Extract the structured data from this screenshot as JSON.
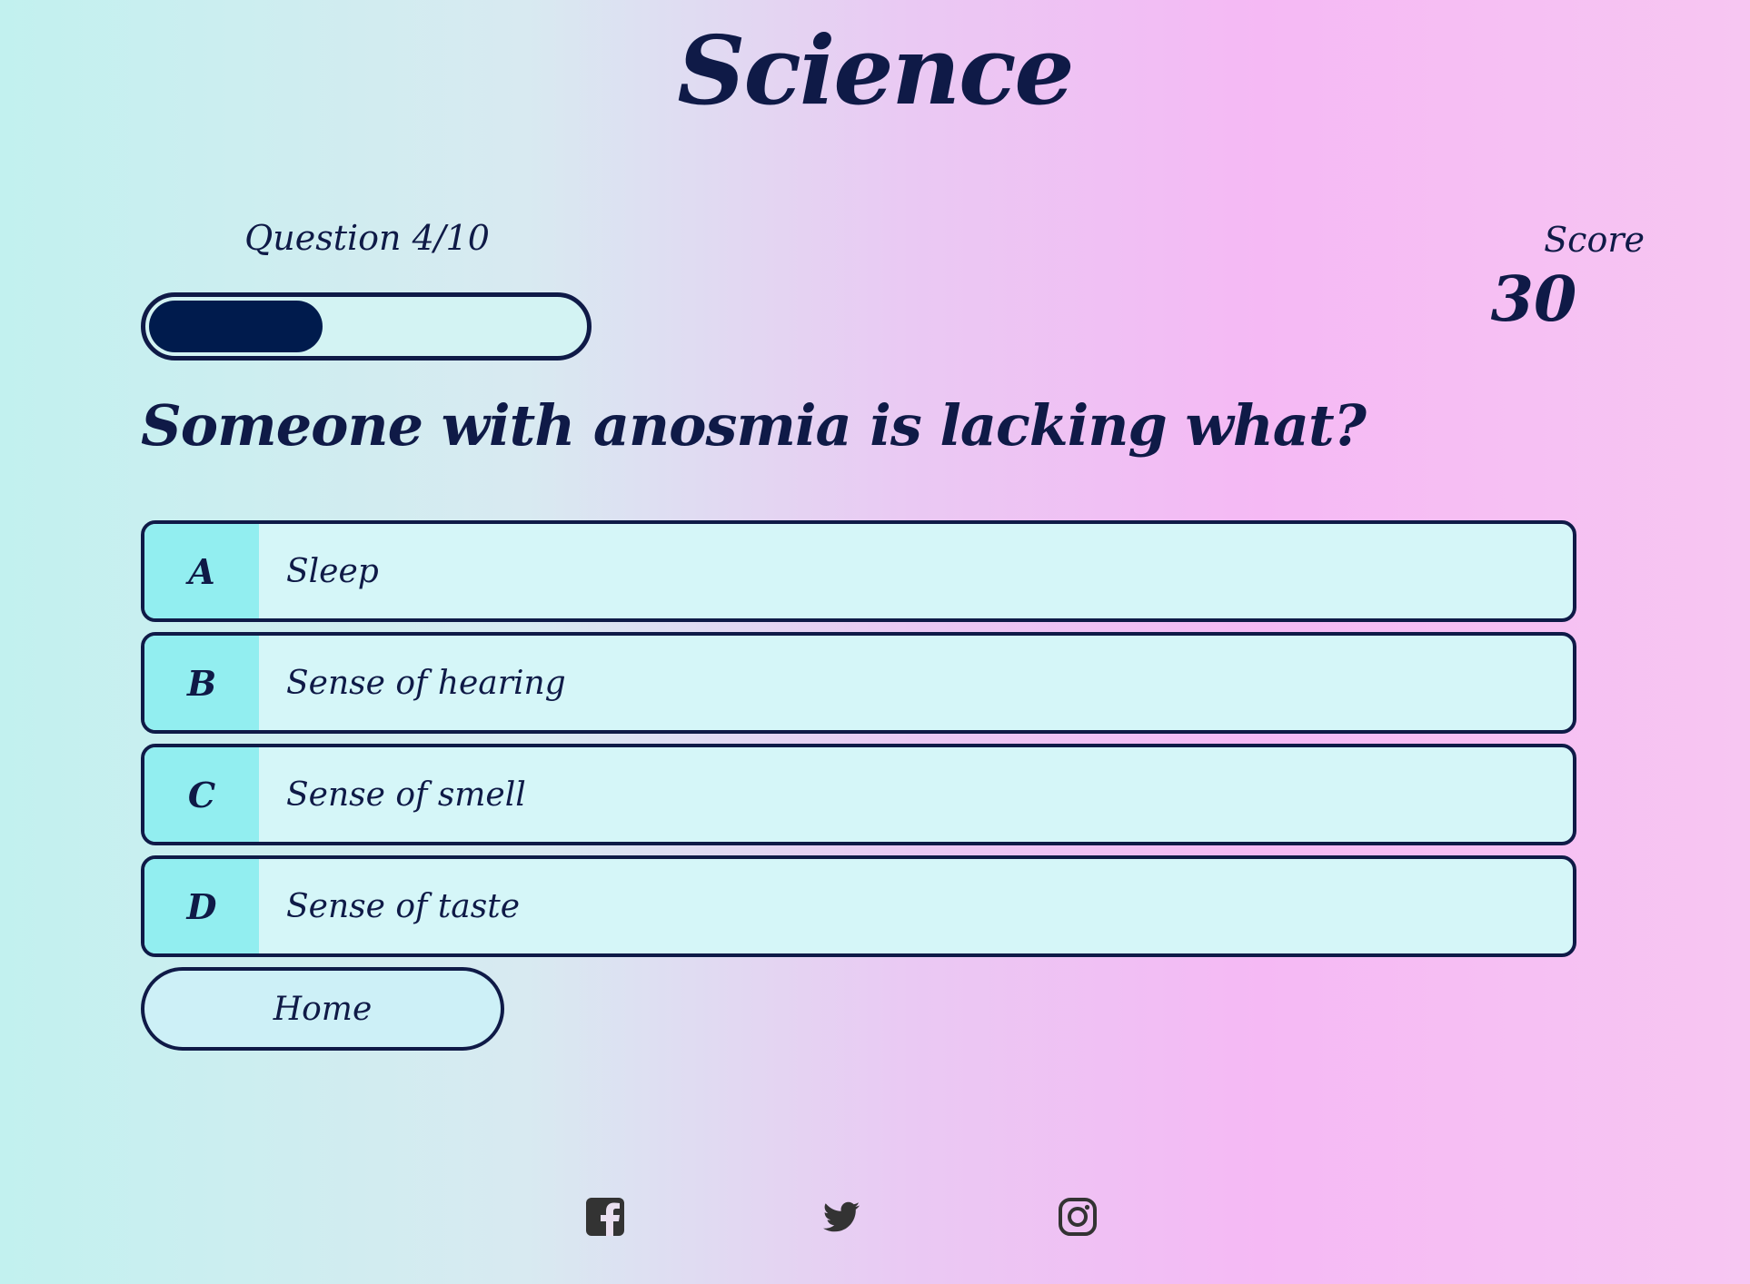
{
  "header": {
    "title": "Science"
  },
  "progress": {
    "label": "Question 4/10",
    "current": 4,
    "total": 10,
    "fraction": 0.4
  },
  "score": {
    "label": "Score",
    "value": "30"
  },
  "question": {
    "text": "Someone with anosmia is lacking what?"
  },
  "answers": [
    {
      "letter": "A",
      "text": "Sleep"
    },
    {
      "letter": "B",
      "text": "Sense of hearing"
    },
    {
      "letter": "C",
      "text": "Sense of smell"
    },
    {
      "letter": "D",
      "text": "Sense of taste"
    }
  ],
  "nav": {
    "home_label": "Home"
  },
  "footer": {
    "icons": [
      "facebook-icon",
      "twitter-icon",
      "instagram-icon"
    ]
  },
  "colors": {
    "text": "#0f1a47",
    "progress_fill": "#001b4d",
    "answer_bg": "#d5f6f8",
    "letter_bg": "#92eef0",
    "icon": "#333333"
  }
}
